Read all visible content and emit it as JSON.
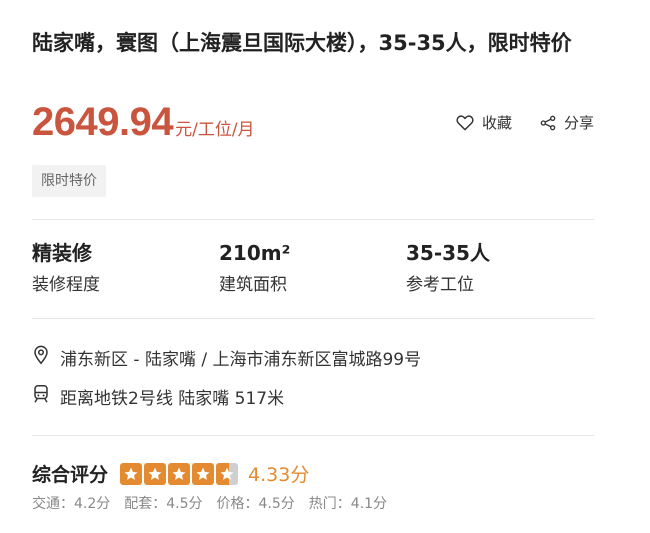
{
  "title": "陆家嘴，寰图（上海震旦国际大楼），35-35人，限时特价",
  "price": {
    "amount": "2649.94",
    "unit": "元/工位/月"
  },
  "actions": {
    "favorite": "收藏",
    "share": "分享"
  },
  "tag": "限时特价",
  "specs": [
    {
      "value": "精装修",
      "label": "装修程度"
    },
    {
      "value": "210m²",
      "label": "建筑面积"
    },
    {
      "value": "35-35人",
      "label": "参考工位"
    }
  ],
  "address": "浦东新区 - 陆家嘴 / 上海市浦东新区富城路99号",
  "metro": "距离地铁2号线 陆家嘴 517米",
  "rating": {
    "title": "综合评分",
    "score": "4.33分",
    "stars_value": 4.33,
    "sub": [
      {
        "text": "交通：4.2分"
      },
      {
        "text": "配套：4.5分"
      },
      {
        "text": "价格：4.5分"
      },
      {
        "text": "热门：4.1分"
      }
    ]
  },
  "colors": {
    "accent": "#c9553f",
    "star": "#e48b31",
    "tag_bg": "#f2f2f2"
  }
}
